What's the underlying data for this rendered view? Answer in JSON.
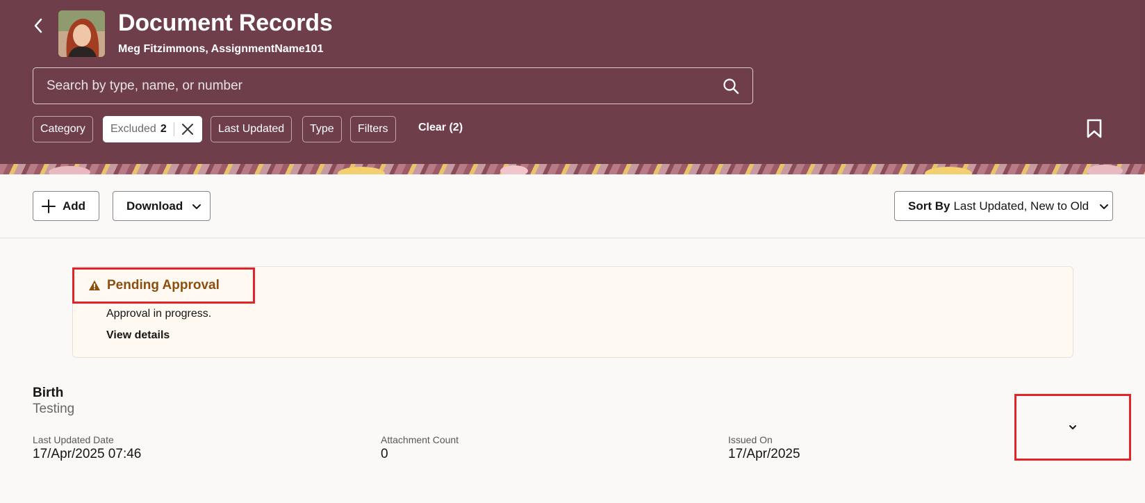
{
  "header": {
    "title": "Document Records",
    "subtitle": "Meg Fitzimmons, AssignmentName101",
    "back_icon": "chevron-left-icon",
    "bookmark_icon": "bookmark-icon",
    "background_color": "#6f3e4b"
  },
  "search": {
    "placeholder": "Search by type, name, or number",
    "value": "",
    "icon": "search-icon"
  },
  "filters": {
    "category_label": "Category",
    "excluded_label": "Excluded",
    "excluded_count": "2",
    "last_updated_label": "Last Updated",
    "type_label": "Type",
    "filters_label": "Filters",
    "clear_label": "Clear (2)"
  },
  "toolbar": {
    "add_label": "Add",
    "download_label": "Download",
    "sort_by_label": "Sort By",
    "sort_value": "Last Updated, New to Old"
  },
  "notice": {
    "title": "Pending Approval",
    "text": "Approval in progress.",
    "link": "View details",
    "icon": "warning-icon",
    "title_color": "#8a4f10"
  },
  "record": {
    "title": "Birth",
    "subtitle": "Testing",
    "fields": [
      {
        "label": "Last Updated Date",
        "value": "17/Apr/2025 07:46"
      },
      {
        "label": "Attachment Count",
        "value": "0"
      },
      {
        "label": "Issued On",
        "value": "17/Apr/2025"
      }
    ],
    "expand_icon": "chevron-down-icon"
  },
  "highlight_color": "#e0242a"
}
